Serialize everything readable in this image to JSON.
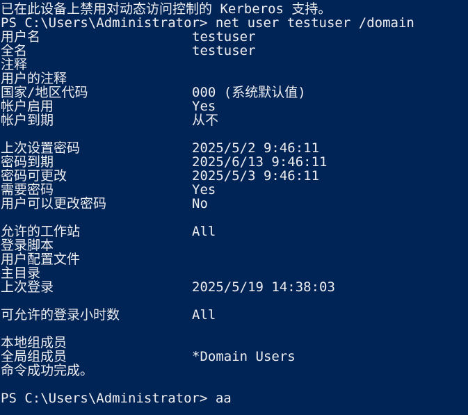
{
  "header_lines": [
    "已在此设备上禁用对动态访问控制的 Kerberos 支持。",
    "PS C:\\Users\\Administrator> net user testuser /domain"
  ],
  "fields": [
    {
      "label": "用户名",
      "value": "testuser"
    },
    {
      "label": "全名",
      "value": "testuser"
    },
    {
      "label": "注释",
      "value": ""
    },
    {
      "label": "用户的注释",
      "value": ""
    },
    {
      "label": "国家/地区代码",
      "value": "000 (系统默认值)"
    },
    {
      "label": "帐户启用",
      "value": "Yes"
    },
    {
      "label": "帐户到期",
      "value": "从不"
    },
    {
      "label": "",
      "value": ""
    },
    {
      "label": "上次设置密码",
      "value": "2025/5/2 9:46:11"
    },
    {
      "label": "密码到期",
      "value": "2025/6/13 9:46:11"
    },
    {
      "label": "密码可更改",
      "value": "2025/5/3 9:46:11"
    },
    {
      "label": "需要密码",
      "value": "Yes"
    },
    {
      "label": "用户可以更改密码",
      "value": "No"
    },
    {
      "label": "",
      "value": ""
    },
    {
      "label": "允许的工作站",
      "value": "All"
    },
    {
      "label": "登录脚本",
      "value": ""
    },
    {
      "label": "用户配置文件",
      "value": ""
    },
    {
      "label": "主目录",
      "value": ""
    },
    {
      "label": "上次登录",
      "value": "2025/5/19 14:38:03"
    },
    {
      "label": "",
      "value": ""
    },
    {
      "label": "可允许的登录小时数",
      "value": "All"
    },
    {
      "label": "",
      "value": ""
    },
    {
      "label": "本地组成员",
      "value": ""
    },
    {
      "label": "全局组成员",
      "value": "*Domain Users"
    }
  ],
  "footer_lines": [
    "命令成功完成。",
    "",
    "PS C:\\Users\\Administrator> aa"
  ]
}
